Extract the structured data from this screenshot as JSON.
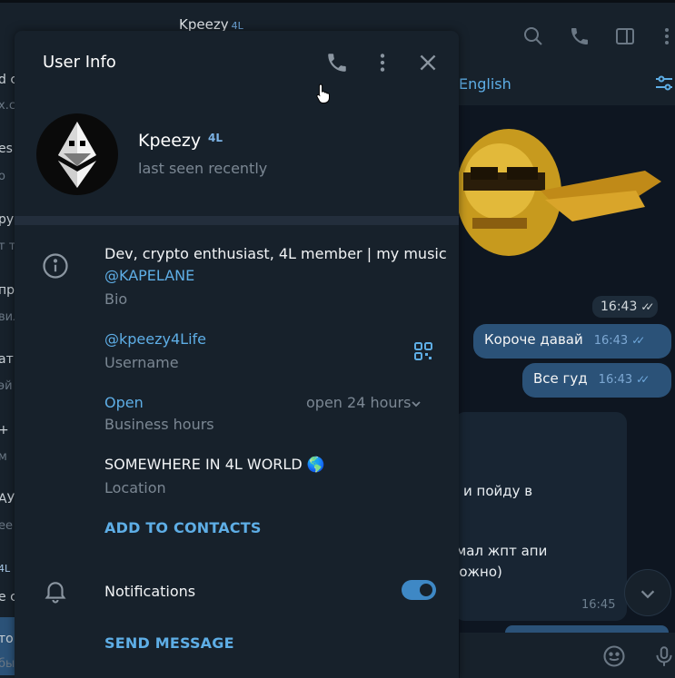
{
  "background": {
    "chat_title": "Kpeezy",
    "chat_badge": "4L",
    "translate_language": "English",
    "sidebar_fragments": [
      "d c",
      "x.c",
      "es",
      "o",
      "ру",
      "т то",
      "пр",
      "вил",
      "ат",
      "эй",
      "+",
      "м",
      "АУ",
      "ее",
      "4L",
      "е с",
      "то",
      "бы"
    ],
    "time_pill": "16:43",
    "messages_out": [
      {
        "text": "Короче давай",
        "time": "16:43"
      },
      {
        "text": "Все гуд",
        "time": "16:43"
      }
    ],
    "incoming_fragments": [
      "и пойду в",
      "гмал жпт апи",
      "можно)"
    ],
    "incoming_time": "16:45"
  },
  "panel": {
    "title": "User Info",
    "profile": {
      "name": "Kpeezy",
      "badge": "4L",
      "status": "last seen recently"
    },
    "bio": {
      "text": "Dev, crypto enthusiast, 4L member | my music",
      "link": "@KAPELANE",
      "label": "Bio"
    },
    "username": {
      "value": "@kpeezy4Life",
      "label": "Username"
    },
    "business_hours": {
      "status": "Open",
      "label": "Business hours",
      "value": "open 24 hours"
    },
    "location": {
      "value": "SOMEWHERE IN 4L WORLD 🌎",
      "label": "Location"
    },
    "add_to_contacts": "ADD TO CONTACTS",
    "notifications": {
      "label": "Notifications",
      "enabled": true
    },
    "send_message": "SEND MESSAGE"
  },
  "colors": {
    "accent": "#5eaee6",
    "panel_bg": "#17212b",
    "app_bg": "#0e1621",
    "outgoing_bubble": "#2b5278"
  },
  "icons": [
    "phone-icon",
    "more-vertical-icon",
    "close-icon",
    "info-icon",
    "qr-code-icon",
    "chevron-down-icon",
    "bell-icon",
    "search-icon",
    "sidebar-toggle-icon",
    "emoji-icon",
    "microphone-icon",
    "filter-icon"
  ]
}
